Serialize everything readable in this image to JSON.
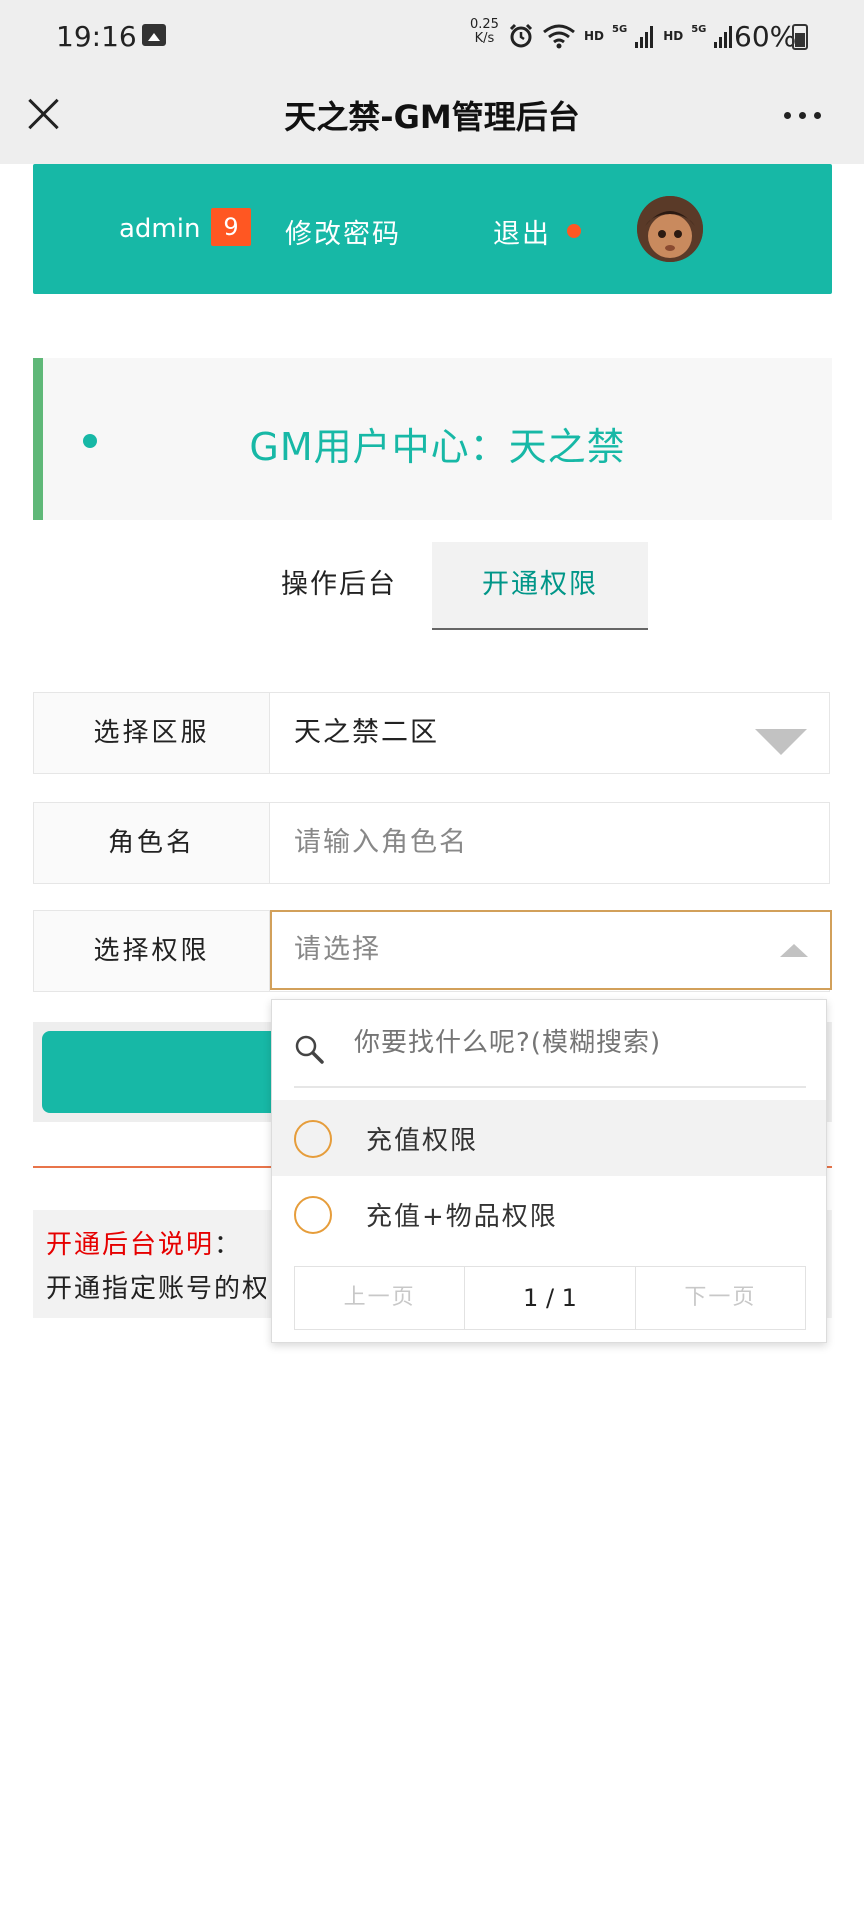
{
  "status_bar": {
    "time": "19:16",
    "net_speed_value": "0.25",
    "net_speed_unit": "K/s",
    "hd1": "HD",
    "sig1": "5G",
    "hd2": "HD",
    "sig2": "5G",
    "battery": "60%"
  },
  "title_bar": {
    "title": "天之禁-GM管理后台"
  },
  "header": {
    "username": "admin",
    "badge_count": "9",
    "change_password": "修改密码",
    "logout": "退出"
  },
  "gm_center": {
    "title": "GM用户中心：天之禁"
  },
  "tabs": [
    {
      "label": "操作后台",
      "active": false
    },
    {
      "label": "开通权限",
      "active": true
    }
  ],
  "form": {
    "server": {
      "label": "选择区服",
      "value": "天之禁二区"
    },
    "role": {
      "label": "角色名",
      "placeholder": "请输入角色名"
    },
    "permission": {
      "label": "选择权限",
      "placeholder": "请选择"
    }
  },
  "dropdown": {
    "search_placeholder": "你要找什么呢?(模糊搜索)",
    "options": [
      {
        "label": "充值权限",
        "highlighted": true
      },
      {
        "label": "充值+物品权限",
        "highlighted": false
      }
    ],
    "pager": {
      "prev": "上一页",
      "current": "1 / 1",
      "next": "下一页"
    }
  },
  "notice": {
    "title": "开通后台说明",
    "colon": "：",
    "body": "开通指定账号的权限"
  },
  "colors": {
    "primary": "#17b8a6",
    "accent": "#ff5722",
    "notice_red": "#e60000",
    "radio_orange": "#e69d3b"
  }
}
